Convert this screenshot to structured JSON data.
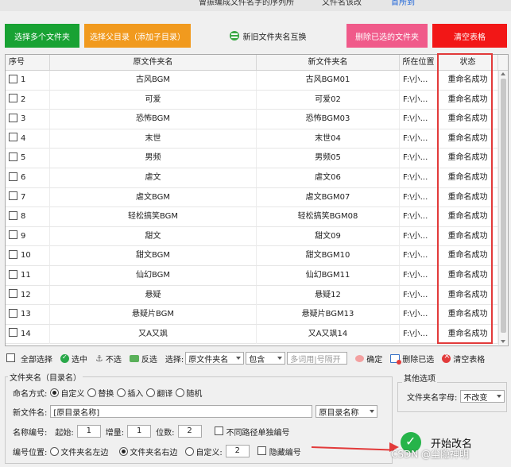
{
  "colors": {
    "btn_select_multi": "#18a233",
    "btn_select_parent": "#f19a1e",
    "btn_delete_selected": "#f05a8a",
    "btn_clear": "#f21717",
    "status_box": "#e23a3a",
    "start_icon": "#26b44a"
  },
  "window_tabs": [
    "曾振编成文件名字的序列所",
    "文件名该改",
    "首所到"
  ],
  "toolbar": {
    "select_multi": "选择多个文件夹",
    "select_parent": "选择父目录（添加子目录）",
    "swap": "新旧文件夹名互换",
    "delete_selected": "删除已选的文件夹",
    "clear_table": "清空表格"
  },
  "table": {
    "headers": {
      "no": "序号",
      "old": "原文件夹名",
      "new": "新文件夹名",
      "location": "所在位置",
      "status": "状态"
    },
    "rows": [
      {
        "no": "1",
        "old": "古风BGM",
        "new": "古风BGM01",
        "location": "F:\\小...",
        "status": "重命名成功"
      },
      {
        "no": "2",
        "old": "可爱",
        "new": "可爱02",
        "location": "F:\\小...",
        "status": "重命名成功"
      },
      {
        "no": "3",
        "old": "恐怖BGM",
        "new": "恐怖BGM03",
        "location": "F:\\小...",
        "status": "重命名成功"
      },
      {
        "no": "4",
        "old": "末世",
        "new": "末世04",
        "location": "F:\\小...",
        "status": "重命名成功"
      },
      {
        "no": "5",
        "old": "男频",
        "new": "男频05",
        "location": "F:\\小...",
        "status": "重命名成功"
      },
      {
        "no": "6",
        "old": "虐文",
        "new": "虐文06",
        "location": "F:\\小...",
        "status": "重命名成功"
      },
      {
        "no": "7",
        "old": "虐文BGM",
        "new": "虐文BGM07",
        "location": "F:\\小...",
        "status": "重命名成功"
      },
      {
        "no": "8",
        "old": "轻松搞笑BGM",
        "new": "轻松搞笑BGM08",
        "location": "F:\\小...",
        "status": "重命名成功"
      },
      {
        "no": "9",
        "old": "甜文",
        "new": "甜文09",
        "location": "F:\\小...",
        "status": "重命名成功"
      },
      {
        "no": "10",
        "old": "甜文BGM",
        "new": "甜文BGM10",
        "location": "F:\\小...",
        "status": "重命名成功"
      },
      {
        "no": "11",
        "old": "仙幻BGM",
        "new": "仙幻BGM11",
        "location": "F:\\小...",
        "status": "重命名成功"
      },
      {
        "no": "12",
        "old": "悬疑",
        "new": "悬疑12",
        "location": "F:\\小...",
        "status": "重命名成功"
      },
      {
        "no": "13",
        "old": "悬疑片BGM",
        "new": "悬疑片BGM13",
        "location": "F:\\小...",
        "status": "重命名成功"
      },
      {
        "no": "14",
        "old": "又A又飒",
        "new": "又A又飒14",
        "location": "F:\\小...",
        "status": "重命名成功"
      }
    ]
  },
  "actions": {
    "select_all": "全部选择",
    "select": "选中",
    "deselect": "不选",
    "invert": "反选",
    "choose_label": "选择:",
    "field_value": "原文件夹名",
    "match_value": "包含",
    "keyword_placeholder": "多词用|号隔开",
    "confirm": "确定",
    "delete_selected": "删除已选",
    "clear_table": "清空表格"
  },
  "options": {
    "group_title": "文件夹名（目录名）",
    "mode_label": "命名方式:",
    "modes": [
      "自定义",
      "替换",
      "插入",
      "翻译",
      "随机"
    ],
    "new_name_label": "新文件名:",
    "new_name_value": "[原目录名称]",
    "name_source_value": "原目录名称",
    "number_label": "名称编号:",
    "start_label": "起始:",
    "start_value": "1",
    "increment_label": "增量:",
    "increment_value": "1",
    "digits_label": "位数:",
    "digits_value": "2",
    "per_path_label": "不同路径单独编号",
    "position_label": "编号位置:",
    "pos_left": "文件夹名左边",
    "pos_right": "文件夹名右边",
    "pos_custom": "自定义:",
    "custom_value": "2",
    "hide_number": "隐藏编号"
  },
  "other": {
    "group_title": "其他选项",
    "case_label": "文件夹名字母:",
    "case_value": "不改变"
  },
  "start_button": "开始改名",
  "watermark": "CSDN @尘隐神明"
}
